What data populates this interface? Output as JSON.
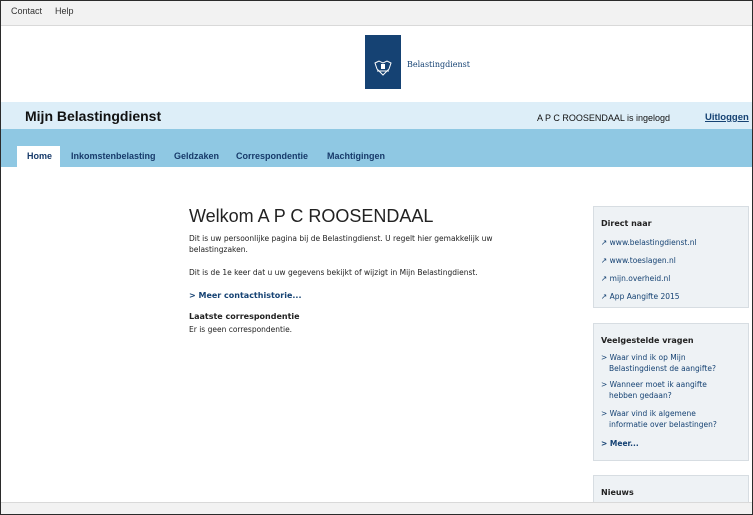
{
  "topbar": {
    "contact": "Contact",
    "help": "Help"
  },
  "logo": {
    "text": "Belastingdienst"
  },
  "header": {
    "title": "Mijn Belastingdienst",
    "login_text": "A P C ROOSENDAAL is ingelogd",
    "logout": "Uitloggen"
  },
  "nav": {
    "items": [
      "Home",
      "Inkomstenbelasting",
      "Geldzaken",
      "Correspondentie",
      "Machtigingen"
    ]
  },
  "main": {
    "welcome": "Welkom A P C ROOSENDAAL",
    "intro_line1": "Dit is uw persoonlijke pagina bij de Belastingdienst. U regelt hier gemakkelijk uw",
    "intro_line2": "belastingzaken.",
    "visit_text": "Dit is de 1e keer dat u uw gegevens bekijkt of wijzigt in Mijn Belastingdienst.",
    "more_contact": "> Meer contacthistorie...",
    "last_corr_title": "Laatste correspondentie",
    "last_corr_text": "Er is geen correspondentie."
  },
  "direct": {
    "title": "Direct naar",
    "links": [
      "www.belastingdienst.nl",
      "www.toeslagen.nl",
      "mijn.overheid.nl",
      "App Aangifte 2015"
    ]
  },
  "faq": {
    "title": "Veelgestelde vragen",
    "q1_line1": "Waar vind ik op Mijn",
    "q1_line2": "Belastingdienst de aangifte?",
    "q2_line1": "Wanneer moet ik aangifte",
    "q2_line2": "hebben gedaan?",
    "q3_line1": "Waar vind ik algemene",
    "q3_line2": "informatie over belastingen?",
    "more": "Meer..."
  },
  "news": {
    "title": "Nieuws"
  },
  "colors": {
    "brand": "#154273",
    "nav_bg": "#8fc8e3",
    "band_bg": "#ddeef8"
  }
}
